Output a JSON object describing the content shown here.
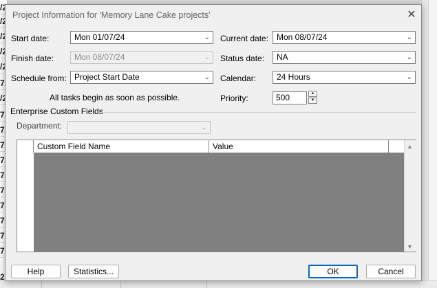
{
  "background": {
    "left_fragments": [
      "/2",
      "/2",
      "/2",
      "/2",
      "/2",
      "7/",
      "/2",
      "7/",
      "7/",
      "7/",
      "7/",
      "7/",
      "7/",
      "7/",
      "7/",
      "7/",
      "7/",
      "24"
    ]
  },
  "dialog": {
    "title": "Project Information for 'Memory Lane Cake projects'",
    "close_glyph": "✕"
  },
  "fields": {
    "start_date": {
      "label": "Start date:",
      "value": "Mon 01/07/24"
    },
    "finish_date": {
      "label": "Finish date:",
      "value": "Mon 08/07/24"
    },
    "schedule_from": {
      "label": "Schedule from:",
      "value": "Project Start Date"
    },
    "current_date": {
      "label": "Current date:",
      "value": "Mon 08/07/24"
    },
    "status_date": {
      "label": "Status date:",
      "value": "NA"
    },
    "calendar": {
      "label": "Calendar:",
      "value": "24 Hours"
    },
    "priority": {
      "label": "Priority:",
      "value": "500"
    }
  },
  "info_text": "All tasks begin as soon as possible.",
  "enterprise": {
    "section_label": "Enterprise Custom Fields",
    "department_label": "Department:",
    "department_value": "",
    "columns": [
      "Custom Field Name",
      "Value"
    ]
  },
  "buttons": {
    "help": "Help",
    "statistics": "Statistics...",
    "ok": "OK",
    "cancel": "Cancel"
  },
  "colors": {
    "grid_fill": "#808080",
    "primary_border": "#0067c0"
  }
}
